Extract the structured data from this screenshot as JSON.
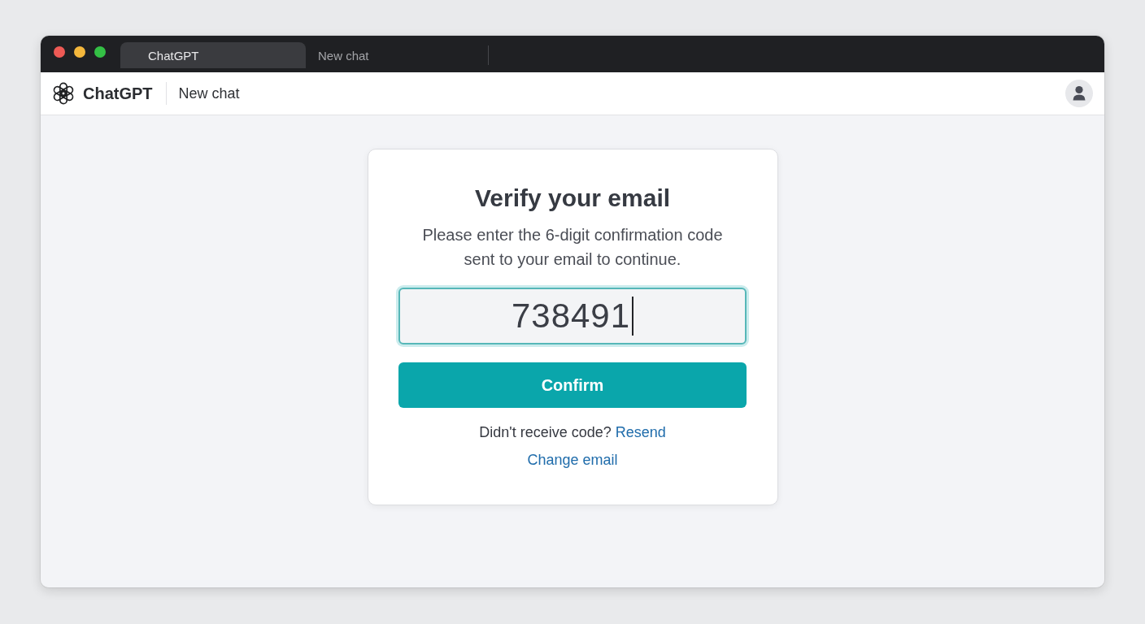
{
  "browser": {
    "tabs": [
      {
        "label": "ChatGPT",
        "selected": true
      },
      {
        "label": "New chat",
        "selected": false
      }
    ]
  },
  "header": {
    "brand": "ChatGPT",
    "page_title": "New chat"
  },
  "verify_card": {
    "title": "Verify your email",
    "instructions": "Please enter the 6-digit confirmation code sent to your email to continue.",
    "code_field": {
      "value": "738491",
      "focused": true
    },
    "confirm_button": "Confirm",
    "resend_prompt": "Didn't receive code?",
    "resend_link": "Resend",
    "change_email_link": "Change email"
  }
}
